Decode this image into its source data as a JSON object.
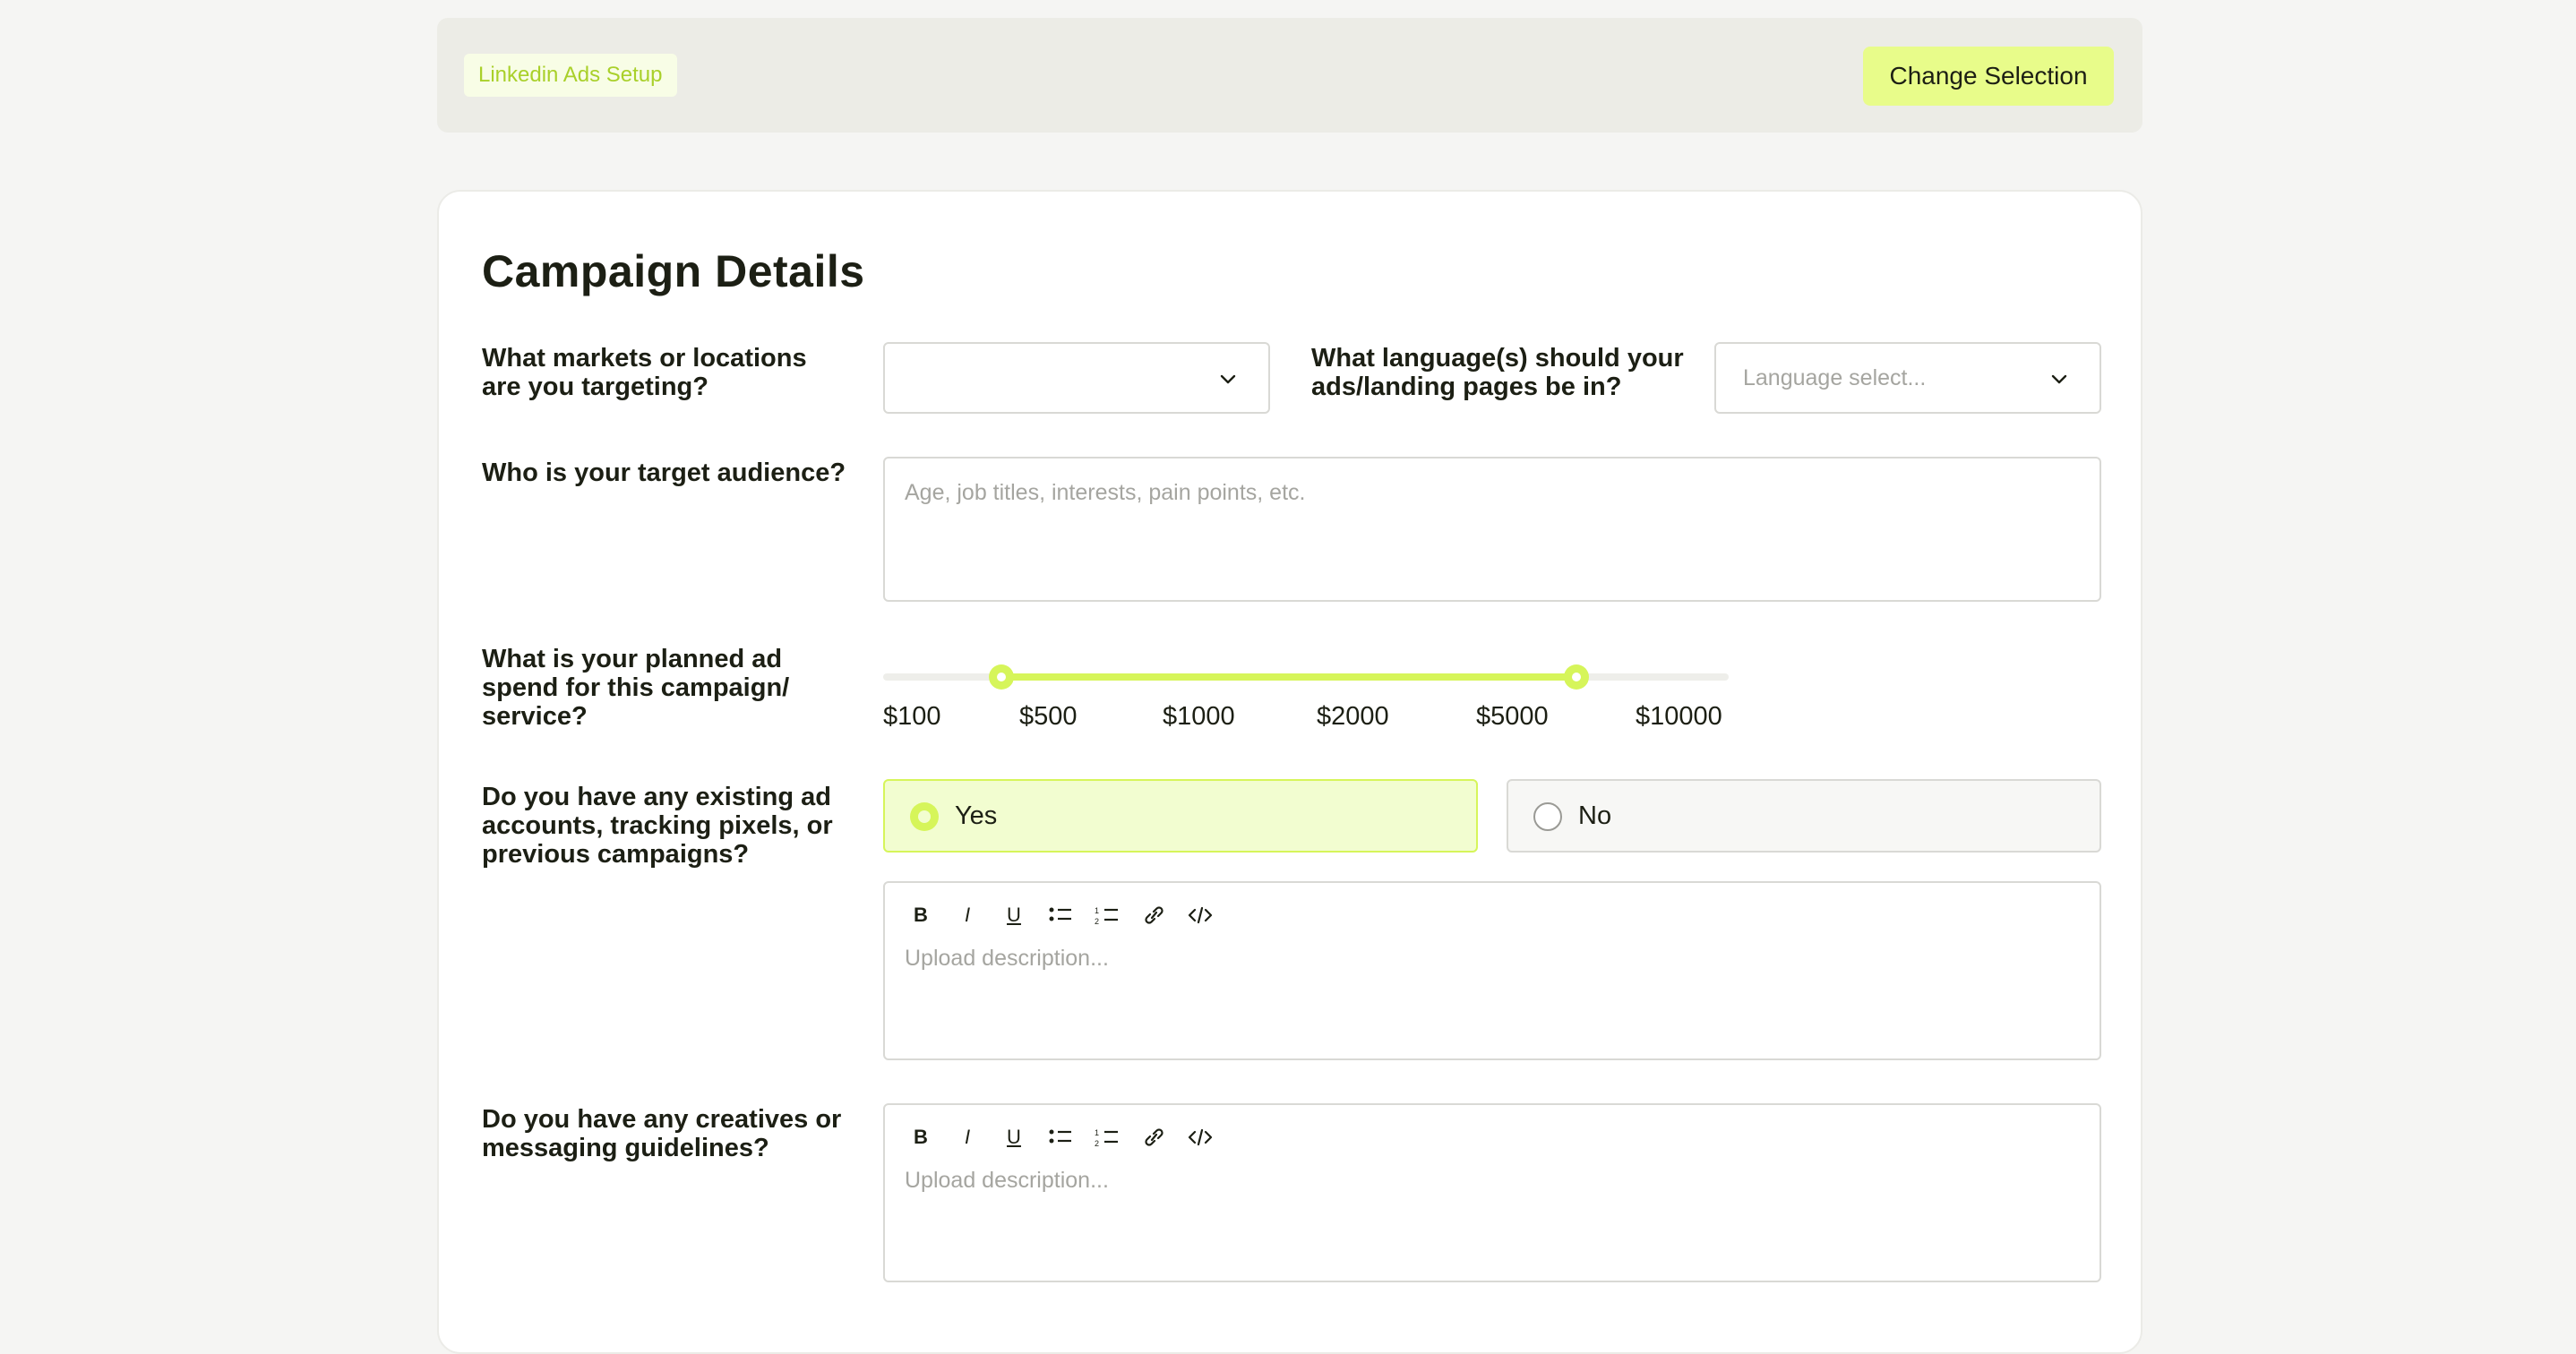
{
  "header": {
    "tag_label": "Linkedin Ads Setup",
    "change_button": "Change Selection"
  },
  "card": {
    "title": "Campaign Details",
    "markets": {
      "label": "What markets or locations are you targeting?",
      "value": ""
    },
    "language": {
      "label": "What language(s) should your ads/landing pages be in?",
      "placeholder": "Language select..."
    },
    "audience": {
      "label": "Who is your target audience?",
      "placeholder": "Age, job titles, interests, pain points, etc."
    },
    "spend": {
      "label": "What is your planned ad spend for this campaign/ service?",
      "ticks": [
        "$100",
        "$500",
        "$1000",
        "$2000",
        "$5000",
        "$10000"
      ],
      "range_low_fraction": 0.14,
      "range_high_fraction": 0.82
    },
    "existing": {
      "label": "Do you have any existing ad accounts, tracking pixels, or previous campaigns?",
      "yes": "Yes",
      "no": "No",
      "selected": "Yes",
      "editor_placeholder": "Upload description..."
    },
    "creatives": {
      "label": "Do you have any creatives or messaging guidelines?",
      "editor_placeholder": "Upload description..."
    },
    "toolbar": {
      "bold": "B",
      "italic": "I",
      "underline": "U"
    }
  },
  "colors": {
    "accent": "#d6f55a",
    "accent_light": "#f2fdd0",
    "button": "#e8fc8a",
    "tag_text": "#a9d02a"
  }
}
